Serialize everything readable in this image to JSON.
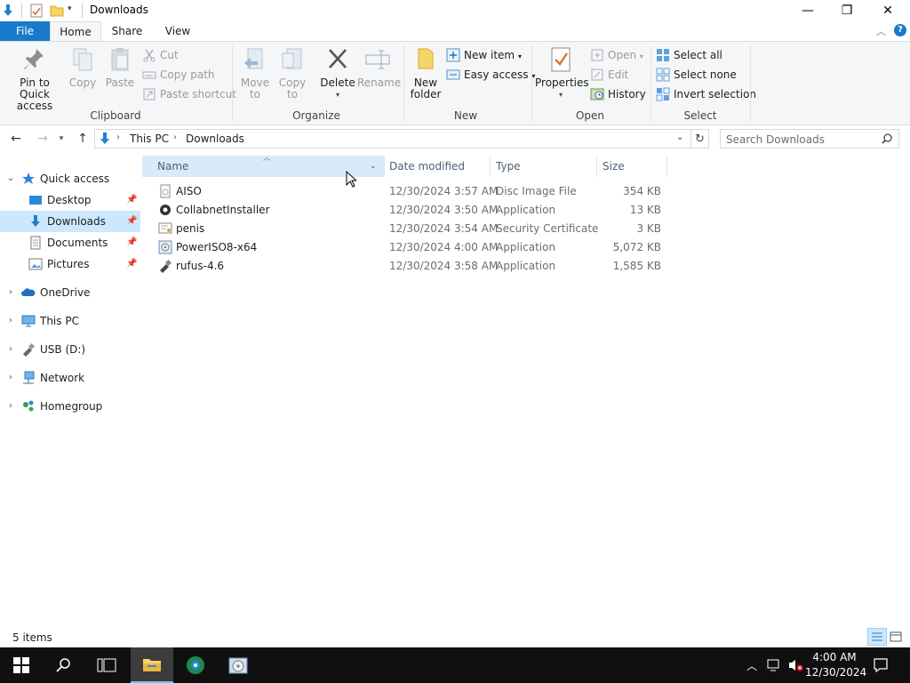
{
  "window": {
    "title": "Downloads",
    "controls": {
      "minimize": "—",
      "restore": "❐",
      "close": "✕"
    }
  },
  "ribbon_tabs": [
    {
      "label": "File",
      "active": false
    },
    {
      "label": "Home",
      "active": true
    },
    {
      "label": "Share",
      "active": false
    },
    {
      "label": "View",
      "active": false
    }
  ],
  "ribbon": {
    "clipboard": {
      "label": "Clipboard",
      "pin_label_1": "Pin to Quick",
      "pin_label_2": "access",
      "copy": "Copy",
      "paste": "Paste",
      "cut": "Cut",
      "copy_path": "Copy path",
      "paste_shortcut": "Paste shortcut"
    },
    "organize": {
      "label": "Organize",
      "move_to_1": "Move",
      "move_to_2": "to",
      "copy_to_1": "Copy",
      "copy_to_2": "to",
      "delete": "Delete",
      "rename": "Rename"
    },
    "new": {
      "label": "New",
      "new_folder_1": "New",
      "new_folder_2": "folder",
      "new_item": "New item",
      "easy_access": "Easy access"
    },
    "open": {
      "label": "Open",
      "properties": "Properties",
      "open": "Open",
      "edit": "Edit",
      "history": "History"
    },
    "select": {
      "label": "Select",
      "select_all": "Select all",
      "select_none": "Select none",
      "invert_selection": "Invert selection"
    }
  },
  "address": {
    "breadcrumbs": [
      "This PC",
      "Downloads"
    ],
    "search_placeholder": "Search Downloads"
  },
  "nav_pane": {
    "quick_access": "Quick access",
    "quick_items": [
      {
        "label": "Desktop",
        "icon": "desktop-icon"
      },
      {
        "label": "Downloads",
        "icon": "downloads-icon",
        "selected": true
      },
      {
        "label": "Documents",
        "icon": "documents-icon"
      },
      {
        "label": "Pictures",
        "icon": "pictures-icon"
      }
    ],
    "roots": [
      {
        "label": "OneDrive",
        "icon": "onedrive-icon"
      },
      {
        "label": "This PC",
        "icon": "this-pc-icon"
      },
      {
        "label": "USB (D:)",
        "icon": "usb-drive-icon"
      },
      {
        "label": "Network",
        "icon": "network-icon"
      },
      {
        "label": "Homegroup",
        "icon": "homegroup-icon"
      }
    ]
  },
  "file_list": {
    "columns": [
      "Name",
      "Date modified",
      "Type",
      "Size"
    ],
    "files": [
      {
        "name": "AISO",
        "date": "12/30/2024 3:57 AM",
        "type": "Disc Image File",
        "size": "354 KB",
        "icon": "disc-image-icon"
      },
      {
        "name": "CollabnetInstaller",
        "date": "12/30/2024 3:50 AM",
        "type": "Application",
        "size": "13 KB",
        "icon": "application-icon"
      },
      {
        "name": "penis",
        "date": "12/30/2024 3:54 AM",
        "type": "Security Certificate",
        "size": "3 KB",
        "icon": "certificate-icon"
      },
      {
        "name": "PowerISO8-x64",
        "date": "12/30/2024 4:00 AM",
        "type": "Application",
        "size": "5,072 KB",
        "icon": "poweriso-icon"
      },
      {
        "name": "rufus-4.6",
        "date": "12/30/2024 3:58 AM",
        "type": "Application",
        "size": "1,585 KB",
        "icon": "rufus-icon"
      }
    ]
  },
  "status": {
    "item_count": "5 items"
  },
  "taskbar": {
    "time": "4:00 AM",
    "date": "12/30/2024"
  },
  "colors": {
    "accent": "#1979ca",
    "selection": "#cce8ff",
    "ribbon_bg": "#f5f6f7",
    "taskbar_bg": "#101010"
  }
}
